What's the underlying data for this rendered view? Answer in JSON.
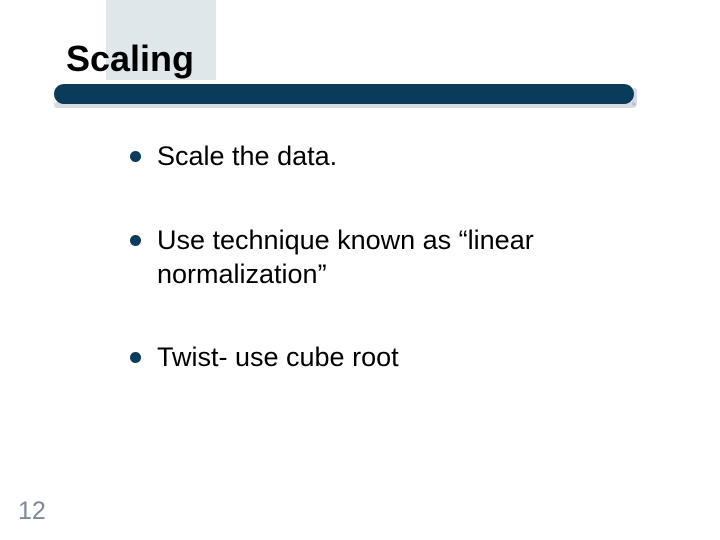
{
  "slide": {
    "title": "Scaling",
    "bullets": [
      "Scale the data.",
      "Use technique known as “linear normalization”",
      "Twist- use cube root"
    ],
    "number": "12"
  }
}
